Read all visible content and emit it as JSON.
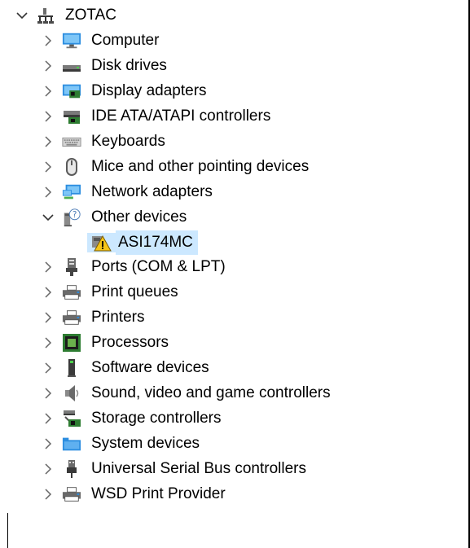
{
  "root": {
    "label": "ZOTAC",
    "expanded": true,
    "icon": "computer-tree-icon"
  },
  "items": [
    {
      "label": "Computer",
      "icon": "monitor-icon",
      "expanded": false
    },
    {
      "label": "Disk drives",
      "icon": "disk-drive-icon",
      "expanded": false
    },
    {
      "label": "Display adapters",
      "icon": "display-adapter-icon",
      "expanded": false
    },
    {
      "label": "IDE ATA/ATAPI controllers",
      "icon": "ide-controller-icon",
      "expanded": false
    },
    {
      "label": "Keyboards",
      "icon": "keyboard-icon",
      "expanded": false
    },
    {
      "label": "Mice and other pointing devices",
      "icon": "mouse-icon",
      "expanded": false
    },
    {
      "label": "Network adapters",
      "icon": "network-adapter-icon",
      "expanded": false
    },
    {
      "label": "Other devices",
      "icon": "unknown-device-icon",
      "expanded": true,
      "children": [
        {
          "label": "ASI174MC",
          "icon": "warning-device-icon",
          "selected": true
        }
      ]
    },
    {
      "label": "Ports (COM & LPT)",
      "icon": "port-icon",
      "expanded": false
    },
    {
      "label": "Print queues",
      "icon": "printer-icon",
      "expanded": false
    },
    {
      "label": "Printers",
      "icon": "printer-icon",
      "expanded": false
    },
    {
      "label": "Processors",
      "icon": "processor-icon",
      "expanded": false
    },
    {
      "label": "Software devices",
      "icon": "software-device-icon",
      "expanded": false
    },
    {
      "label": "Sound, video and game controllers",
      "icon": "speaker-icon",
      "expanded": false
    },
    {
      "label": "Storage controllers",
      "icon": "storage-controller-icon",
      "expanded": false
    },
    {
      "label": "System devices",
      "icon": "system-folder-icon",
      "expanded": false
    },
    {
      "label": "Universal Serial Bus controllers",
      "icon": "usb-icon",
      "expanded": false
    },
    {
      "label": "WSD Print Provider",
      "icon": "printer-icon",
      "expanded": false
    }
  ],
  "colors": {
    "selection": "#cce8ff",
    "chevron": "#555555"
  }
}
